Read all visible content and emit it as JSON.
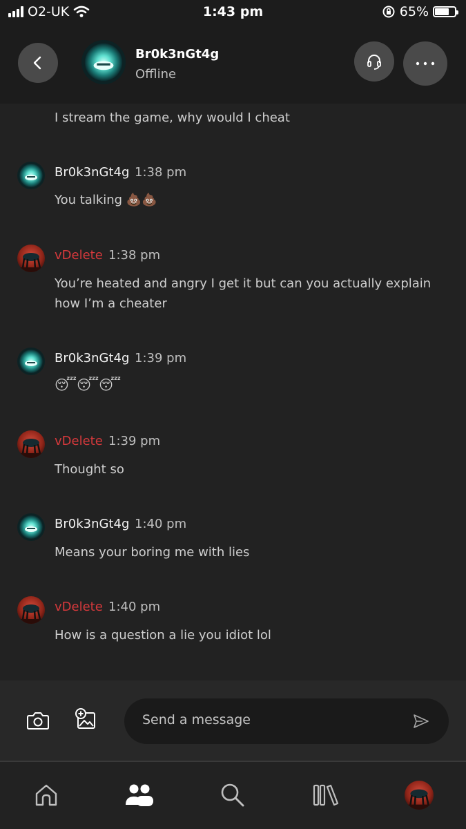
{
  "status_bar": {
    "carrier": "O2-UK",
    "time": "1:43 pm",
    "battery": "65%",
    "battery_level": 0.65
  },
  "header": {
    "contact_name": "Br0k3nGt4g",
    "contact_status": "Offline",
    "icons": [
      "chevron-left-icon",
      "headset-icon",
      "more-icon"
    ]
  },
  "messages": [
    {
      "sender": "",
      "time": "",
      "text": "I stream the game, why would I cheat"
    },
    {
      "sender": "Br0k3nGt4g",
      "time": "1:38 pm",
      "text": "You talking 💩💩"
    },
    {
      "sender": "vDelete",
      "time": "1:38 pm",
      "text": "You’re heated and angry I get it but can you actually explain how I’m a cheater"
    },
    {
      "sender": "Br0k3nGt4g",
      "time": "1:39 pm",
      "text": "😴😴😴"
    },
    {
      "sender": "vDelete",
      "time": "1:39 pm",
      "text": "Thought so"
    },
    {
      "sender": "Br0k3nGt4g",
      "time": "1:40 pm",
      "text": "Means your boring me with lies"
    },
    {
      "sender": "vDelete",
      "time": "1:40 pm",
      "text": "How is a question a lie you idiot lol"
    }
  ],
  "composer": {
    "placeholder": "Send a message",
    "icons": [
      "camera-icon",
      "add-image-icon",
      "send-icon"
    ]
  },
  "bottom_nav": {
    "icons": [
      "home-icon",
      "people-icon",
      "search-icon",
      "library-icon",
      "profile-avatar"
    ]
  },
  "colors": {
    "background": "#222222",
    "header": "#1c1c1c",
    "vdelete_name": "#d7393c",
    "input": "#1a1a1a"
  }
}
